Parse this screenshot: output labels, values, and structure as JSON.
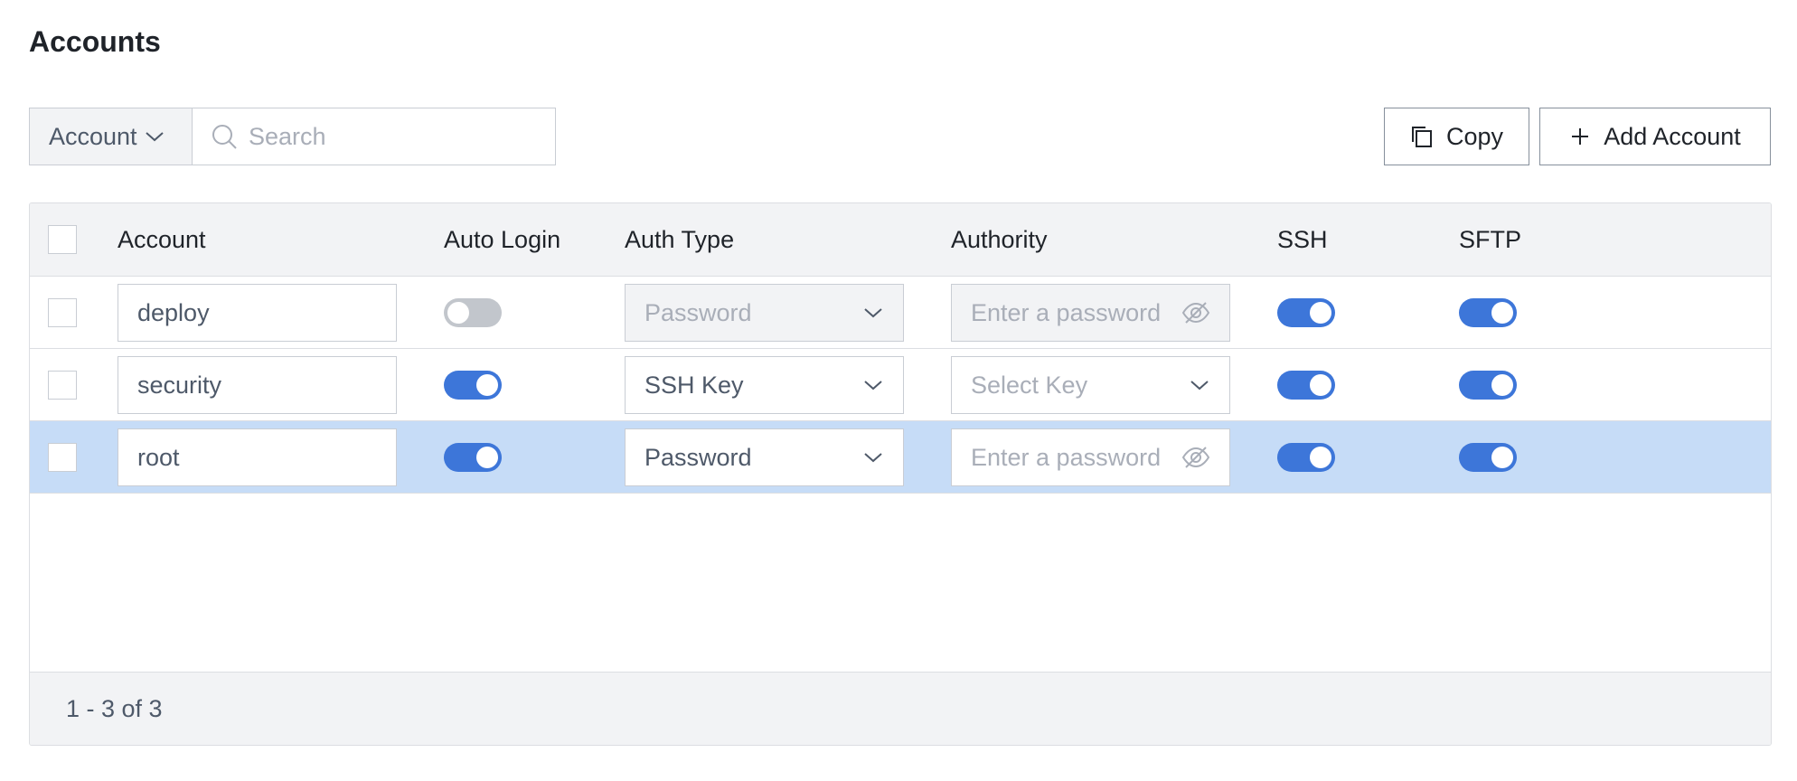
{
  "page": {
    "title": "Accounts"
  },
  "toolbar": {
    "filter_label": "Account",
    "search_placeholder": "Search",
    "copy_label": "Copy",
    "add_label": "Add Account"
  },
  "table": {
    "columns": {
      "account": "Account",
      "auto_login": "Auto Login",
      "auth_type": "Auth Type",
      "authority": "Authority",
      "ssh": "SSH",
      "sftp": "SFTP"
    },
    "rows": [
      {
        "checked": false,
        "selected": false,
        "account": "deploy",
        "auto_login": false,
        "auth_type": "Password",
        "auth_type_disabled": true,
        "authority_kind": "password",
        "authority_placeholder": "Enter a password",
        "authority_disabled": true,
        "ssh": true,
        "sftp": true
      },
      {
        "checked": false,
        "selected": false,
        "account": "security",
        "auto_login": true,
        "auth_type": "SSH Key",
        "auth_type_disabled": false,
        "authority_kind": "select",
        "authority_placeholder": "Select Key",
        "authority_disabled": false,
        "ssh": true,
        "sftp": true
      },
      {
        "checked": false,
        "selected": true,
        "account": "root",
        "auto_login": true,
        "auth_type": "Password",
        "auth_type_disabled": false,
        "authority_kind": "password",
        "authority_placeholder": "Enter a password",
        "authority_disabled": false,
        "ssh": true,
        "sftp": true
      }
    ],
    "pagination": "1 - 3 of 3"
  },
  "colors": {
    "accent": "#3d76d9",
    "selected_row": "#c6dcf7",
    "header_bg": "#f2f3f5",
    "toggle_off": "#c2c6cc"
  },
  "icons": {
    "filter_dropdown": "chevron-down-icon",
    "search": "search-icon",
    "copy": "copy-icon",
    "add": "plus-icon",
    "select_dropdown": "chevron-down-icon",
    "password_visibility": "eye-off-icon"
  }
}
